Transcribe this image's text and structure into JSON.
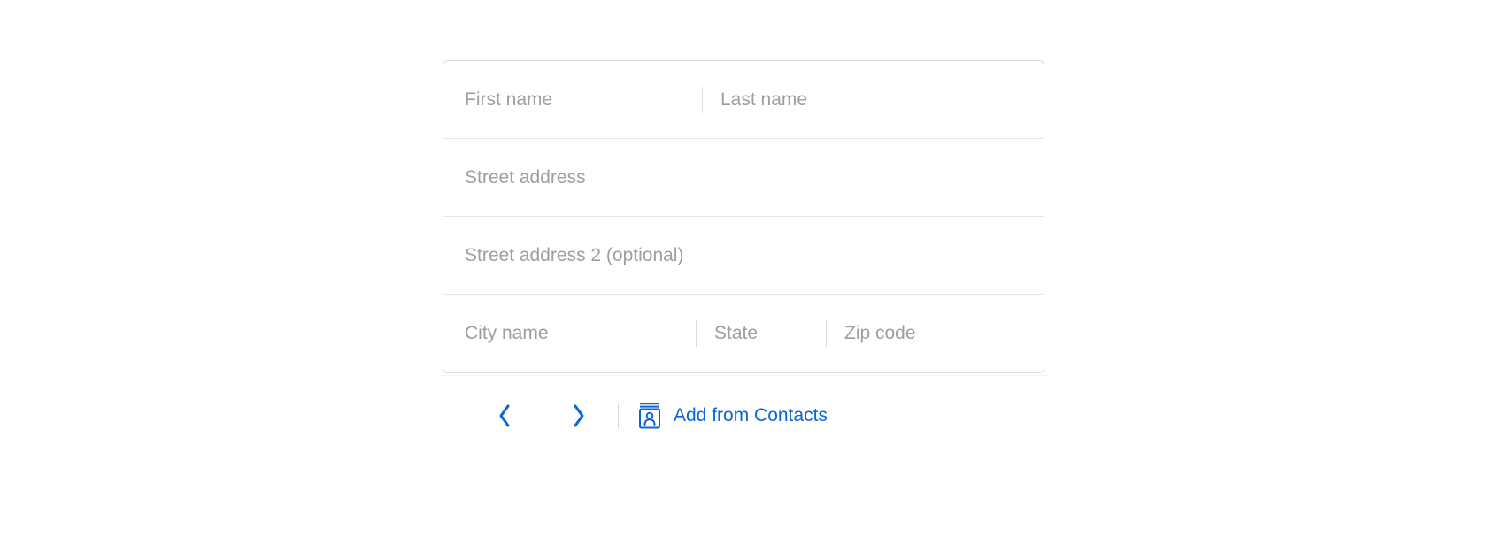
{
  "address_form": {
    "first_name": {
      "value": "",
      "placeholder": "First name"
    },
    "last_name": {
      "value": "",
      "placeholder": "Last name"
    },
    "street1": {
      "value": "",
      "placeholder": "Street address"
    },
    "street2": {
      "value": "",
      "placeholder": "Street address 2 (optional)"
    },
    "city": {
      "value": "",
      "placeholder": "City name"
    },
    "state": {
      "value": "",
      "placeholder": "State"
    },
    "zip": {
      "value": "",
      "placeholder": "Zip code"
    }
  },
  "toolbar": {
    "add_from_contacts_label": "Add from Contacts"
  },
  "colors": {
    "accent": "#0a66d6",
    "placeholder": "#9a9fa4",
    "border": "#d9dbdd"
  }
}
